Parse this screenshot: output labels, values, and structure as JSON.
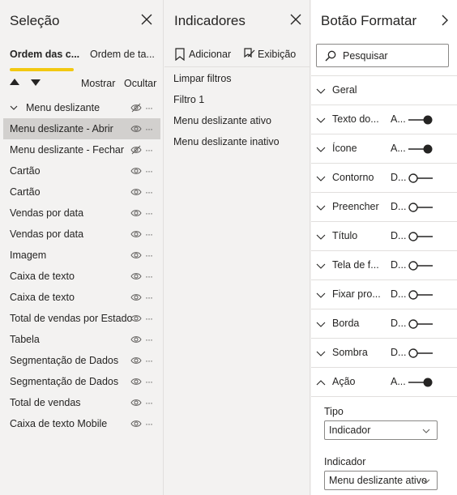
{
  "selection": {
    "title": "Seleção",
    "tabs": [
      "Ordem das c...",
      "Ordem de ta..."
    ],
    "show_label": "Mostrar",
    "hide_label": "Ocultar",
    "group": "Menu deslizante",
    "items": [
      "Menu deslizante - Abrir",
      "Menu deslizante - Fechar",
      "Cartão",
      "Cartão",
      "Vendas por data",
      "Vendas por data",
      "Imagem",
      "Caixa de texto",
      "Caixa de texto",
      "Total de vendas por Estado",
      "Tabela",
      "Segmentação de Dados",
      "Segmentação de Dados",
      "Total de vendas",
      "Caixa de texto Mobile"
    ],
    "selected_item": "Menu deslizante - Abrir"
  },
  "indicators": {
    "title": "Indicadores",
    "add_label": "Adicionar",
    "view_label": "Exibição",
    "items": [
      "Limpar filtros",
      "Filtro 1",
      "Menu deslizante ativo",
      "Menu deslizante inativo"
    ]
  },
  "format": {
    "title": "Botão Formatar",
    "search_placeholder": "Pesquisar",
    "sections": [
      {
        "label": "Geral",
        "state": "",
        "toggle": null
      },
      {
        "label": "Texto do...",
        "state": "A...",
        "toggle": "on"
      },
      {
        "label": "Ícone",
        "state": "A...",
        "toggle": "on"
      },
      {
        "label": "Contorno",
        "state": "D...",
        "toggle": "off"
      },
      {
        "label": "Preencher",
        "state": "D...",
        "toggle": "off"
      },
      {
        "label": "Título",
        "state": "D...",
        "toggle": "off"
      },
      {
        "label": "Tela de f...",
        "state": "D...",
        "toggle": "off"
      },
      {
        "label": "Fixar pro...",
        "state": "D...",
        "toggle": "off"
      },
      {
        "label": "Borda",
        "state": "D...",
        "toggle": "off"
      },
      {
        "label": "Sombra",
        "state": "D...",
        "toggle": "off"
      },
      {
        "label": "Ação",
        "state": "A...",
        "toggle": "on"
      }
    ],
    "type_label": "Tipo",
    "type_value": "Indicador",
    "indicator_label": "Indicador",
    "indicator_value": "Menu deslizante ativo"
  },
  "colors": {
    "accent_underline": "#f2c811",
    "selected_row": "#d2d0ce",
    "toggle": "#252423"
  }
}
